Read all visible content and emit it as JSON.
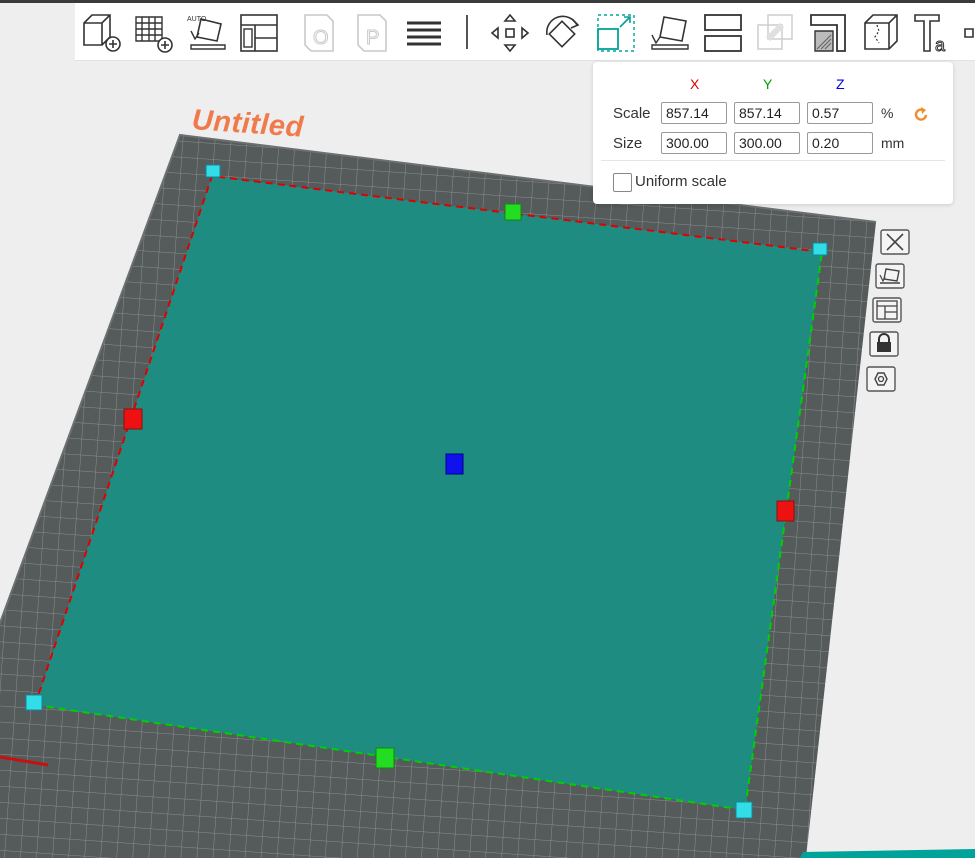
{
  "project": {
    "title": "Untitled"
  },
  "toolbar": {
    "buttons": [
      {
        "name": "add-model-button",
        "icon": "cube-plus-icon",
        "enabled": true
      },
      {
        "name": "add-plate-button",
        "icon": "grid-plus-icon",
        "enabled": true
      },
      {
        "name": "auto-orient-button",
        "icon": "auto-orient-icon",
        "label": "AUTO",
        "enabled": true
      },
      {
        "name": "arrange-button",
        "icon": "arrange-icon",
        "enabled": true
      },
      {
        "name": "orient-button",
        "icon": "orient-icon",
        "label": "O",
        "enabled": false
      },
      {
        "name": "plate-button",
        "icon": "plate-icon",
        "label": "P",
        "enabled": false
      },
      {
        "name": "layers-button",
        "icon": "layers-icon",
        "enabled": true
      },
      {
        "name": "move-button",
        "icon": "move-icon",
        "enabled": true
      },
      {
        "name": "rotate-button",
        "icon": "rotate-icon",
        "enabled": true
      },
      {
        "name": "scale-button",
        "icon": "scale-icon",
        "enabled": true,
        "active": true
      },
      {
        "name": "lay-on-face-button",
        "icon": "lay-on-face-icon",
        "enabled": true
      },
      {
        "name": "cut-button",
        "icon": "cut-icon",
        "enabled": true
      },
      {
        "name": "mesh-boolean-button",
        "icon": "boolean-icon",
        "enabled": false
      },
      {
        "name": "support-paint-button",
        "icon": "support-paint-icon",
        "enabled": true
      },
      {
        "name": "seam-paint-button",
        "icon": "seam-paint-icon",
        "enabled": true
      },
      {
        "name": "text-button",
        "icon": "text-icon",
        "label": "T",
        "sub": "a",
        "enabled": true
      }
    ]
  },
  "scale_panel": {
    "axis_x": "X",
    "axis_y": "Y",
    "axis_z": "Z",
    "scale_label": "Scale",
    "size_label": "Size",
    "scale": {
      "x": "857.14",
      "y": "857.14",
      "z": "0.57",
      "unit": "%"
    },
    "size": {
      "x": "300.00",
      "y": "300.00",
      "z": "0.20",
      "unit": "mm"
    },
    "uniform_scale_label": "Uniform scale",
    "uniform_scale_checked": false
  },
  "plate_side_buttons": [
    {
      "name": "plate-delete-button",
      "icon": "close-icon"
    },
    {
      "name": "plate-orient-button",
      "icon": "orient-icon"
    },
    {
      "name": "plate-arrange-button",
      "icon": "arrange-icon"
    },
    {
      "name": "plate-lock-button",
      "icon": "lock-icon"
    },
    {
      "name": "plate-settings-button",
      "icon": "hex-settings-icon"
    }
  ],
  "colors": {
    "axis_x": "#e00000",
    "axis_y": "#00a000",
    "axis_z": "#0000e0",
    "title": "#f07a4a",
    "model_fill": "#1f8c81",
    "plate": "#555a5b",
    "accent": "#00a39a",
    "reset_icon": "#f08c2a"
  }
}
